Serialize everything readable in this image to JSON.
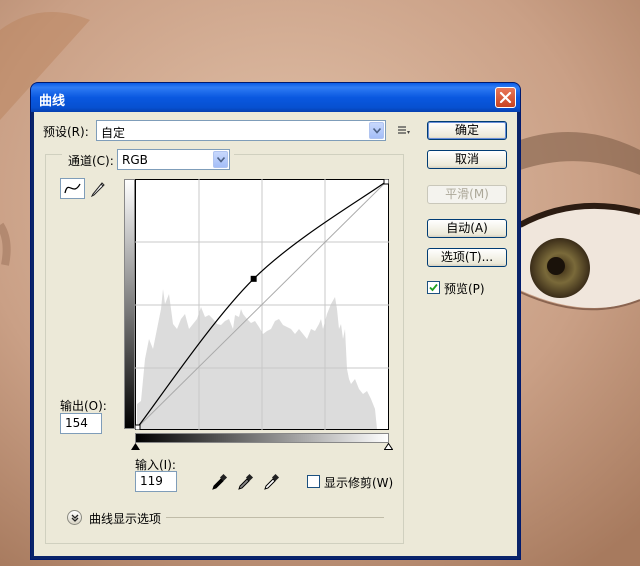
{
  "window": {
    "title": "曲线"
  },
  "preset": {
    "label": "预设(R):",
    "value": "自定"
  },
  "channel": {
    "label": "通道(C):",
    "value": "RGB"
  },
  "buttons": {
    "ok": "确定",
    "cancel": "取消",
    "smooth": "平滑(M)",
    "auto": "自动(A)",
    "options": "选项(T)..."
  },
  "preview": {
    "label": "预览(P)",
    "checked": true
  },
  "output": {
    "label": "输出(O):",
    "value": "154"
  },
  "input": {
    "label": "输入(I):",
    "value": "119"
  },
  "show_clipping": {
    "label": "显示修剪(W)",
    "checked": false
  },
  "curve_display_options": {
    "label": "曲线显示选项"
  },
  "icons": {
    "curve_tool": "curve-point-icon",
    "pencil_tool": "pencil-icon",
    "preset_menu": "preset-menu-icon",
    "eyedroppers": [
      "black-eyedropper-icon",
      "gray-eyedropper-icon",
      "white-eyedropper-icon"
    ]
  },
  "curve": {
    "control_points": [
      [
        0,
        0
      ],
      [
        119,
        154
      ],
      [
        255,
        255
      ]
    ]
  }
}
